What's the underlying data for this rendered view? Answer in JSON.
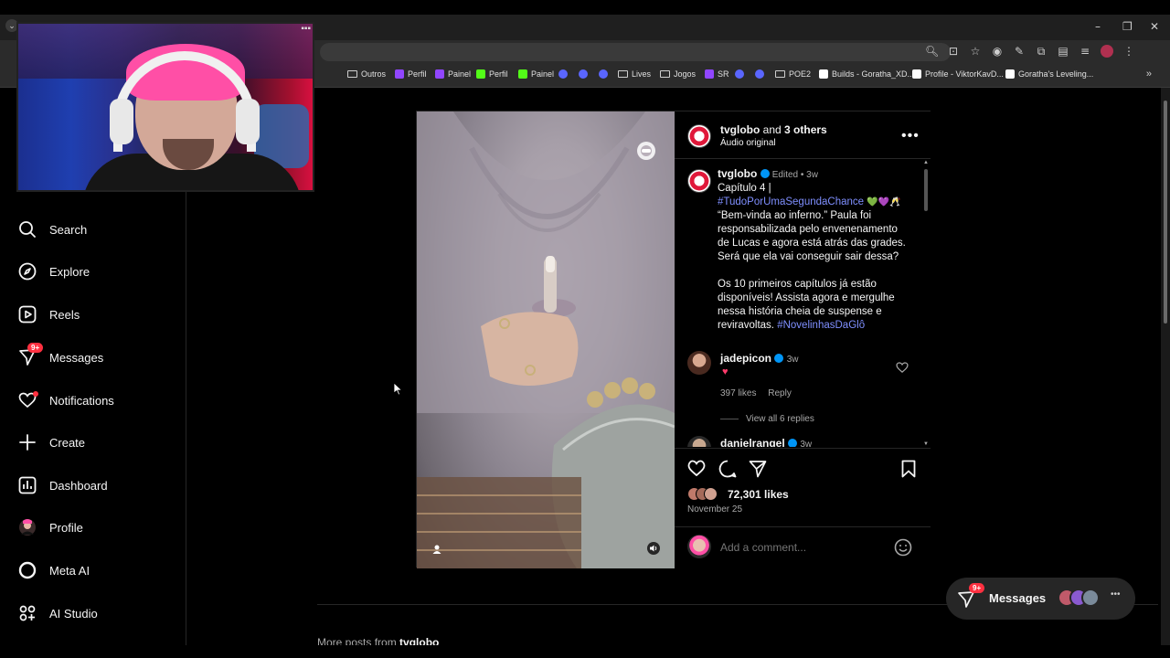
{
  "bookmarks": [
    {
      "label": "Outros",
      "kind": "folder"
    },
    {
      "label": "Perfil",
      "kind": "twitch"
    },
    {
      "label": "Painel",
      "kind": "twitch"
    },
    {
      "label": "Perfil",
      "kind": "kick"
    },
    {
      "label": "Painel",
      "kind": "kick"
    },
    {
      "label": "",
      "kind": "app"
    },
    {
      "label": "",
      "kind": "app"
    },
    {
      "label": "",
      "kind": "app"
    },
    {
      "label": "Lives",
      "kind": "folder"
    },
    {
      "label": "Jogos",
      "kind": "folder"
    },
    {
      "label": "SR",
      "kind": "twitch"
    },
    {
      "label": "",
      "kind": "app"
    },
    {
      "label": "",
      "kind": "app"
    },
    {
      "label": "POE2",
      "kind": "folder"
    },
    {
      "label": "Builds - Goratha_XD...",
      "kind": "site"
    },
    {
      "label": "Profile - ViktorKavD...",
      "kind": "site"
    },
    {
      "label": "Goratha's Leveling...",
      "kind": "site"
    }
  ],
  "sidebar": {
    "items": [
      {
        "label": "Search",
        "icon": "search-icon"
      },
      {
        "label": "Explore",
        "icon": "compass-icon"
      },
      {
        "label": "Reels",
        "icon": "reels-icon"
      },
      {
        "label": "Messages",
        "icon": "messenger-icon",
        "badge": "9+"
      },
      {
        "label": "Notifications",
        "icon": "heart-icon"
      },
      {
        "label": "Create",
        "icon": "plus-icon"
      },
      {
        "label": "Dashboard",
        "icon": "dashboard-icon"
      },
      {
        "label": "Profile",
        "icon": "avatar"
      },
      {
        "label": "Meta AI",
        "icon": "meta-ai-icon"
      },
      {
        "label": "AI Studio",
        "icon": "ai-studio-icon"
      }
    ]
  },
  "post": {
    "header_user": "tvglobo",
    "header_and": "and",
    "header_others": "3 others",
    "audio": "Áudio original",
    "caption_user": "tvglobo",
    "caption_meta": "Edited • 3w",
    "caption_line1": "Capítulo 4 |",
    "caption_tag1": "#TudoPorUmaSegundaChance",
    "caption_body": "“Bem-vinda ao inferno.” Paula foi responsabilizada pelo envenenamento de Lucas e agora está atrás das grades. Será que ela vai conseguir sair dessa?",
    "caption_body2": "Os 10 primeiros capítulos já estão disponíveis! Assista agora e mergulhe nessa história cheia de suspense e reviravoltas.",
    "caption_tag2": "#NovelinhasDaGlô",
    "comments": [
      {
        "user": "jadepicon",
        "time": "3w",
        "likes": "397 likes",
        "reply": "Reply",
        "view_replies": "View all 6 replies"
      },
      {
        "user": "danielrangel",
        "time": "3w"
      }
    ],
    "likes": "72,301 likes",
    "date": "November 25",
    "add_comment_placeholder": "Add a comment..."
  },
  "messages_bar": {
    "label": "Messages",
    "badge": "9+"
  },
  "more_posts": {
    "prefix": "More posts from",
    "user": "tvglobo"
  },
  "colors": {
    "accent_link": "#7f8fff",
    "badge_red": "#ff3040",
    "verified": "#0095f6"
  }
}
